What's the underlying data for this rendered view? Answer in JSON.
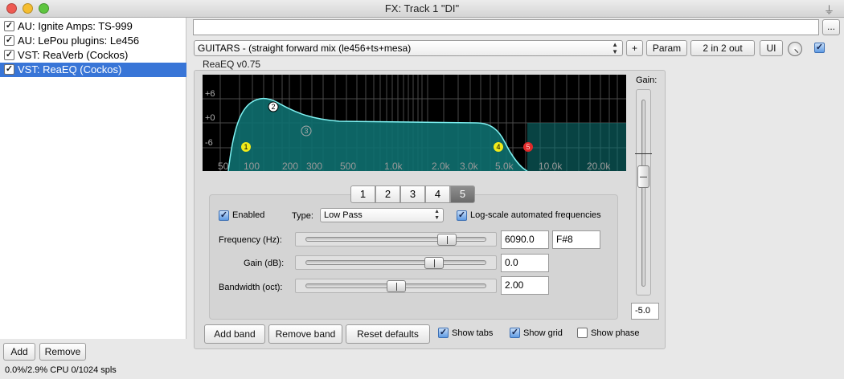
{
  "window": {
    "title": "FX: Track 1 \"DI\"",
    "pin_glyph": "⏚",
    "traffic_colors": [
      "#ee5a52",
      "#f5bd30",
      "#5ec53f"
    ]
  },
  "fx_chain": [
    {
      "label": "AU: Ignite Amps: TS-999",
      "enabled": true,
      "selected": false
    },
    {
      "label": "AU: LePou plugins: Le456",
      "enabled": true,
      "selected": false
    },
    {
      "label": "VST: ReaVerb (Cockos)",
      "enabled": true,
      "selected": false
    },
    {
      "label": "VST: ReaEQ (Cockos)",
      "enabled": true,
      "selected": true
    }
  ],
  "chain_buttons": {
    "add": "Add",
    "remove": "Remove"
  },
  "status_text": "0.0%/2.9% CPU 0/1024 spls",
  "top": {
    "browse_label": "...",
    "preset": "GUITARS - (straight forward mix (le456+ts+mesa)",
    "plus_label": "+",
    "param_label": "Param",
    "io_label": "2 in 2 out",
    "ui_label": "UI",
    "plugin_enabled": true
  },
  "plugin_name": "ReaEQ v0.75",
  "eq_graph": {
    "db_labels": [
      "+6",
      "+0",
      "-6"
    ],
    "freq_labels": [
      "50",
      "100",
      "200",
      "300",
      "500",
      "1.0k",
      "2.0k",
      "3.0k",
      "5.0k",
      "10.0k",
      "20.0k"
    ],
    "band_numbers": [
      "1",
      "2",
      "3",
      "4",
      "5"
    ]
  },
  "gain": {
    "label": "Gain:",
    "value": "-5.0",
    "level": 0.59
  },
  "band_tabs": [
    "1",
    "2",
    "3",
    "4",
    "5"
  ],
  "active_band": 4,
  "band": {
    "enabled_label": "Enabled",
    "enabled": true,
    "type_label": "Type:",
    "type_value": "Low Pass",
    "log_scale_label": "Log-scale automated frequencies",
    "log_scale": true,
    "frequency": {
      "label": "Frequency (Hz):",
      "value": "6090.0",
      "note": "F#8",
      "position": 0.78
    },
    "gain": {
      "label": "Gain (dB):",
      "value": "0.0",
      "position": 0.71
    },
    "bandwidth": {
      "label": "Bandwidth (oct):",
      "value": "2.00",
      "position": 0.5
    }
  },
  "bottom": {
    "add_band": "Add band",
    "remove_band": "Remove band",
    "reset_defaults": "Reset defaults",
    "show_tabs": {
      "label": "Show tabs",
      "checked": true
    },
    "show_grid": {
      "label": "Show grid",
      "checked": true
    },
    "show_phase": {
      "label": "Show phase",
      "checked": false
    }
  }
}
